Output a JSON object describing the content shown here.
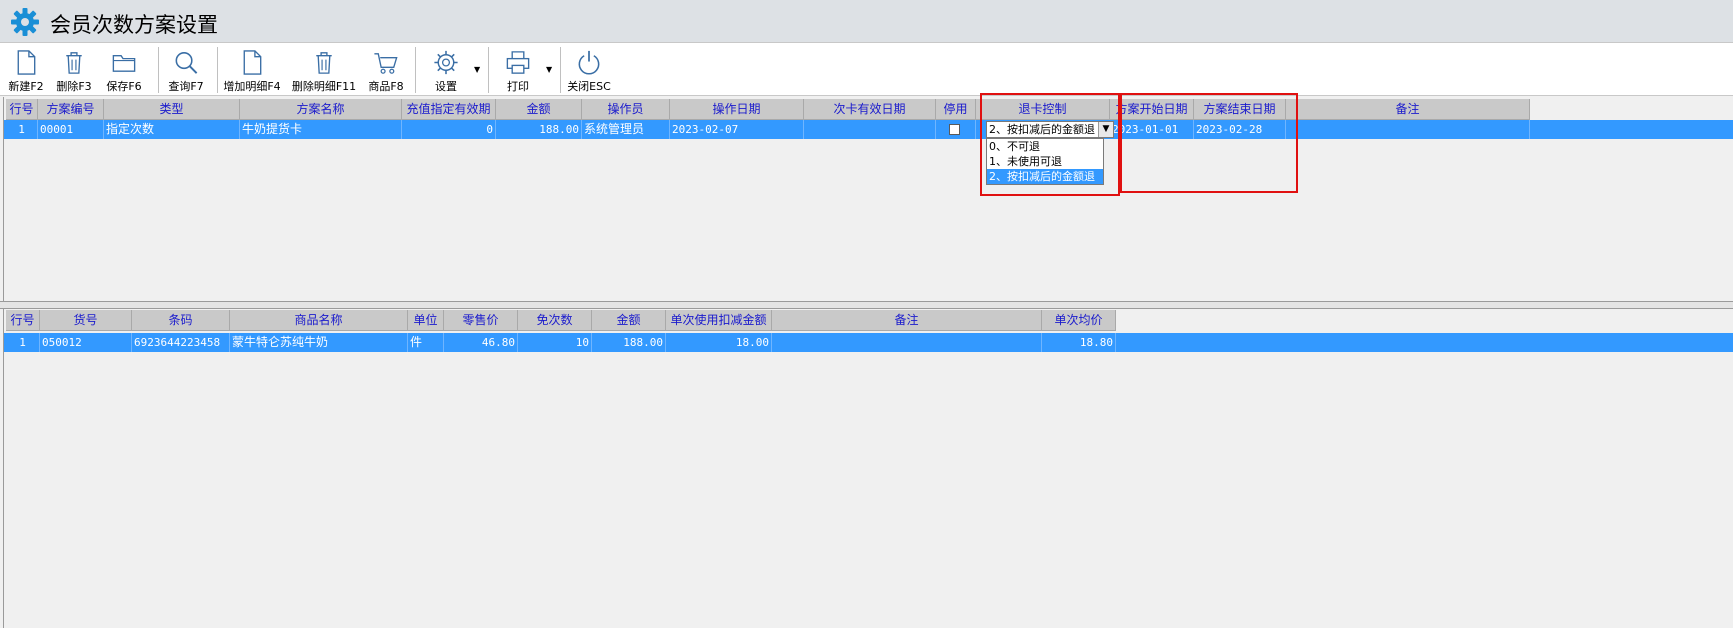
{
  "window": {
    "title": "会员次数方案设置",
    "icon": "gear-icon",
    "accent": "#1a8fd6"
  },
  "toolbar": {
    "buttons": [
      {
        "label": "新建F2",
        "icon": "new-document-icon"
      },
      {
        "label": "删除F3",
        "icon": "trash-icon"
      },
      {
        "label": "保存F6",
        "icon": "folder-icon"
      },
      {
        "label": "查询F7",
        "icon": "search-icon"
      },
      {
        "label": "增加明细F4",
        "icon": "new-document-icon"
      },
      {
        "label": "删除明细F11",
        "icon": "trash-icon"
      },
      {
        "label": "商品F8",
        "icon": "cart-icon"
      },
      {
        "label": "设置",
        "icon": "gear-icon"
      },
      {
        "label": "打印",
        "icon": "printer-icon"
      },
      {
        "label": "关闭ESC",
        "icon": "power-icon"
      }
    ]
  },
  "top_grid": {
    "headers": [
      "行号",
      "方案编号",
      "类型",
      "方案名称",
      "充值指定有效期",
      "金额",
      "操作员",
      "操作日期",
      "次卡有效日期",
      "停用",
      "退卡控制",
      "方案开始日期",
      "方案结束日期",
      "备注"
    ],
    "rows": [
      {
        "row_no": "1",
        "plan_no": "00001",
        "type": "指定次数",
        "plan_name": "牛奶提货卡",
        "recharge_validity": "0",
        "amount": "188.00",
        "operator": "系统管理员",
        "op_date": "2023-02-07",
        "card_valid_date": "",
        "disabled": false,
        "refund_control": "2、按扣减后的金额退",
        "start_date": "2023-01-01",
        "end_date": "2023-02-28",
        "note": ""
      }
    ],
    "refund_options": [
      "0、不可退",
      "1、未使用可退",
      "2、按扣减后的金额退"
    ],
    "refund_selected_index": 2
  },
  "bottom_grid": {
    "headers": [
      "行号",
      "货号",
      "条码",
      "商品名称",
      "单位",
      "零售价",
      "免次数",
      "金额",
      "单次使用扣减金额",
      "备注",
      "单次均价"
    ],
    "rows": [
      {
        "row_no": "1",
        "item_no": "050012",
        "barcode": "6923644223458",
        "product_name": "蒙牛特仑苏纯牛奶",
        "unit": "件",
        "retail_price": "46.80",
        "free_times": "10",
        "amount": "188.00",
        "deduct_per_use": "18.00",
        "note": "",
        "avg_price": "18.80"
      }
    ]
  },
  "colors": {
    "header_text": "#1a1acd",
    "header_bg": "#c9c9c9",
    "selected_row": "#3399ff",
    "highlight_box": "#e01010"
  }
}
